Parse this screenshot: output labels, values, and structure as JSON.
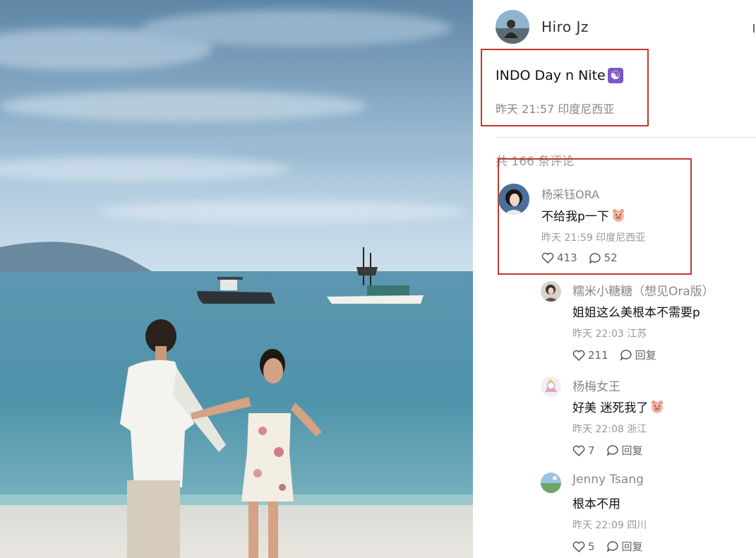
{
  "post": {
    "author": "Hiro  Jz",
    "title": "INDO Day n Nite",
    "title_emoji": "yin-yang-icon",
    "meta": "昨天 21:57 印度尼西亚"
  },
  "comments_header": "共 166 条评论",
  "colors": {
    "highlight_box": "#c0392b",
    "muted": "#999999",
    "name": "#888888"
  },
  "main_comment": {
    "user": "杨采钰ORA",
    "text": "不给我p一下",
    "text_emoji": "pig-face-icon",
    "meta": "昨天 21:59 印度尼西亚",
    "likes": "413",
    "replies": "52"
  },
  "replies": [
    {
      "user": "糯米小糖糖（想见Ora版）",
      "text": "姐姐这么美根本不需要p",
      "meta": "昨天 22:03 江苏",
      "likes": "211",
      "reply_label": "回复"
    },
    {
      "user": "杨梅女王",
      "text": "好美 迷死我了",
      "text_emoji": "pig-face-icon",
      "meta": "昨天 22:08 浙江",
      "likes": "7",
      "reply_label": "回复"
    },
    {
      "user": "Jenny Tsang",
      "text": "根本不用",
      "meta": "昨天 22:09 四川",
      "likes": "5",
      "reply_label": "回复"
    }
  ]
}
